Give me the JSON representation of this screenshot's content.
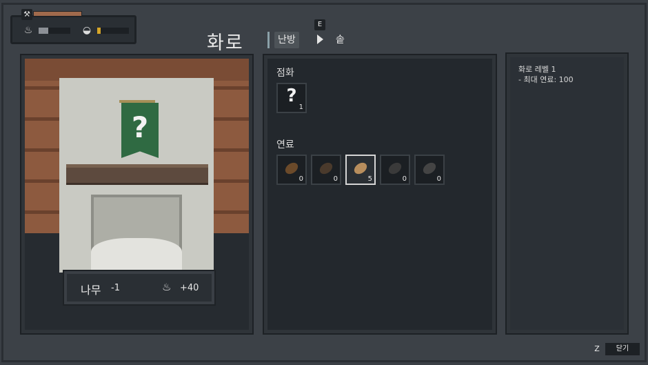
{
  "hud": {
    "tool_icon": "hammer-icon",
    "health_fraction": 1.0,
    "fire": {
      "icon": "campfire-icon",
      "fraction": 0.3
    },
    "food": {
      "icon": "cooking-pot-icon",
      "fraction": 0.1
    }
  },
  "header": {
    "title": "화로",
    "active_tab": "난방",
    "next_tab_key": "E",
    "next_tab": "솥"
  },
  "ignition": {
    "label": "점화",
    "slot": {
      "icon": "unknown-item-icon",
      "symbol": "?",
      "count": "1"
    }
  },
  "fuel": {
    "label": "연료",
    "items": [
      {
        "icon": "leaf-icon",
        "count": "0",
        "selected": false,
        "color": "#6b4a2a"
      },
      {
        "icon": "twig-icon",
        "count": "0",
        "selected": false,
        "color": "#4a3a2c"
      },
      {
        "icon": "log-icon",
        "count": "5",
        "selected": true,
        "color": "#b88e5d"
      },
      {
        "icon": "charcoal-icon",
        "count": "0",
        "selected": false,
        "color": "#3a3a3a"
      },
      {
        "icon": "coal-icon",
        "count": "0",
        "selected": false,
        "color": "#444444"
      }
    ]
  },
  "selected_fuel": {
    "name": "나무",
    "amount": "-1",
    "heat_icon": "campfire-icon",
    "heat": "+40"
  },
  "info": {
    "line1": "화로 레벨 1",
    "line2": "- 최대 연료: 100"
  },
  "footer": {
    "close_key": "Z",
    "close_label": "닫기"
  },
  "colors": {
    "background": "#3c4147",
    "panel": "#23282d",
    "banner": "#2f6a42",
    "health": "#a06a4c",
    "food_bar": "#d6a628"
  }
}
